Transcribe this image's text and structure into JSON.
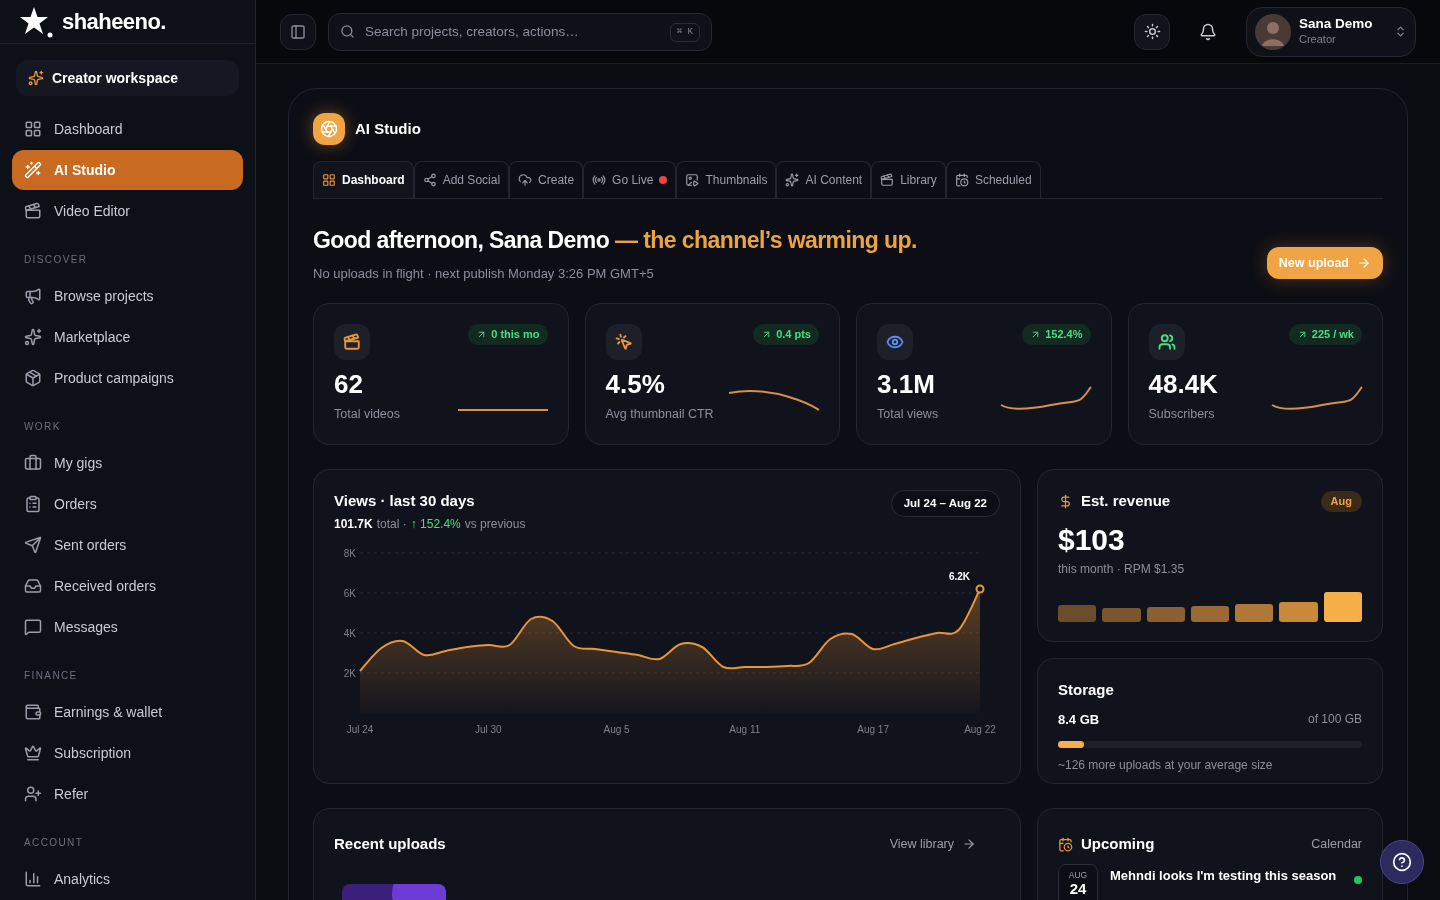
{
  "brand": {
    "name": "shaheeno."
  },
  "sidebar": {
    "workspace": "Creator workspace",
    "sections": [
      {
        "items": [
          {
            "label": "Dashboard",
            "selected": false
          },
          {
            "label": "AI Studio",
            "selected": true
          },
          {
            "label": "Video Editor",
            "selected": false
          }
        ]
      },
      {
        "title": "DISCOVER",
        "items": [
          {
            "label": "Browse projects",
            "selected": false
          },
          {
            "label": "Marketplace",
            "selected": false
          },
          {
            "label": "Product campaigns",
            "selected": false
          }
        ]
      },
      {
        "title": "WORK",
        "items": [
          {
            "label": "My gigs",
            "selected": false
          },
          {
            "label": "Orders",
            "selected": false
          },
          {
            "label": "Sent orders",
            "selected": false
          },
          {
            "label": "Received orders",
            "selected": false
          },
          {
            "label": "Messages",
            "selected": false
          }
        ]
      },
      {
        "title": "FINANCE",
        "items": [
          {
            "label": "Earnings & wallet",
            "selected": false
          },
          {
            "label": "Subscription",
            "selected": false
          },
          {
            "label": "Refer",
            "selected": false
          }
        ]
      },
      {
        "title": "ACCOUNT",
        "items": [
          {
            "label": "Analytics",
            "selected": false
          }
        ]
      }
    ]
  },
  "topbar": {
    "search": {
      "placeholder": "Search projects, creators, actions…",
      "shortcut": "⌘ K"
    },
    "user": {
      "name": "Sana Demo",
      "role": "Creator"
    }
  },
  "studio": {
    "title": "AI Studio",
    "tabs": [
      {
        "label": "Dashboard",
        "selected": true,
        "live": false
      },
      {
        "label": "Add Social",
        "selected": false,
        "live": false
      },
      {
        "label": "Create",
        "selected": false,
        "live": false
      },
      {
        "label": "Go Live",
        "selected": false,
        "live": true
      },
      {
        "label": "Thumbnails",
        "selected": false,
        "live": false
      },
      {
        "label": "AI Content",
        "selected": false,
        "live": false
      },
      {
        "label": "Library",
        "selected": false,
        "live": false
      },
      {
        "label": "Scheduled",
        "selected": false,
        "live": false
      }
    ],
    "greeting": "Good afternoon, Sana Demo",
    "greeting_accent": "— the channel’s warming up.",
    "subtitle": "No uploads in flight · next publish Monday 3:26 PM GMT+5",
    "new_upload": "New upload",
    "kpis": [
      {
        "value": "62",
        "label": "Total videos",
        "change": "0 this mo",
        "color": "#e8963a"
      },
      {
        "value": "4.5%",
        "label": "Avg thumbnail CTR",
        "change": "0.4 pts",
        "color": "#e8963a"
      },
      {
        "value": "3.1M",
        "label": "Total views",
        "change": "152.4%",
        "color": "#5b8def"
      },
      {
        "value": "48.4K",
        "label": "Subscribers",
        "change": "225 / wk",
        "color": "#4ade80"
      }
    ],
    "views": {
      "total": "101.7K",
      "total_label": "total ·",
      "change": "↑ 152.4%",
      "change_label": "vs previous",
      "range": "Jul 24 – Aug 22",
      "chart_data": {
        "type": "area",
        "title": "Views · last 30 days",
        "categories": [
          "Jul 24",
          null,
          null,
          null,
          null,
          null,
          "Jul 30",
          null,
          null,
          null,
          null,
          null,
          "Aug 5",
          null,
          null,
          null,
          null,
          null,
          "Aug 11",
          null,
          null,
          null,
          null,
          null,
          "Aug 17",
          null,
          null,
          null,
          null,
          "Aug 22"
        ],
        "series": [
          {
            "color": "#e8963a",
            "values": [
              2.1,
              3.25,
              3.6,
              2.9,
              3.1,
              3.3,
              3.4,
              3.4,
              4.7,
              4.6,
              3.35,
              3.2,
              3.05,
              2.9,
              2.7,
              3.45,
              3.3,
              2.3,
              2.3,
              2.3,
              2.35,
              2.5,
              3.7,
              3.95,
              3.2,
              3.45,
              3.75,
              4.0,
              4.15,
              6.2
            ]
          }
        ],
        "ylim": [
          0,
          8
        ],
        "grid": true,
        "yticks": [
          {
            "value": 2,
            "label": "2K"
          },
          {
            "value": 4,
            "label": "4K"
          },
          {
            "value": 6,
            "label": "6K"
          },
          {
            "value": 8,
            "label": "8K"
          }
        ],
        "annotations": [
          {
            "x": "Aug 22",
            "y": 6.2,
            "text": "6.2K"
          }
        ]
      }
    },
    "revenue": {
      "title": "Est. revenue",
      "badge": "Aug",
      "value": "$103",
      "caption": "this month · RPM $1.35"
    },
    "storage": {
      "title": "Storage",
      "used": "8.4 GB",
      "total": "of 100 GB",
      "level": 0.084,
      "caption": "~126 more uploads at your average size"
    },
    "recent": {
      "title": "Recent uploads",
      "link": "View library"
    },
    "upcoming": {
      "title": "Upcoming",
      "link": "Calendar",
      "items": [
        {
          "month": "AUG",
          "day": "24",
          "title": "Mehndi looks I'm testing this season",
          "color": "#22c55e"
        }
      ]
    }
  }
}
